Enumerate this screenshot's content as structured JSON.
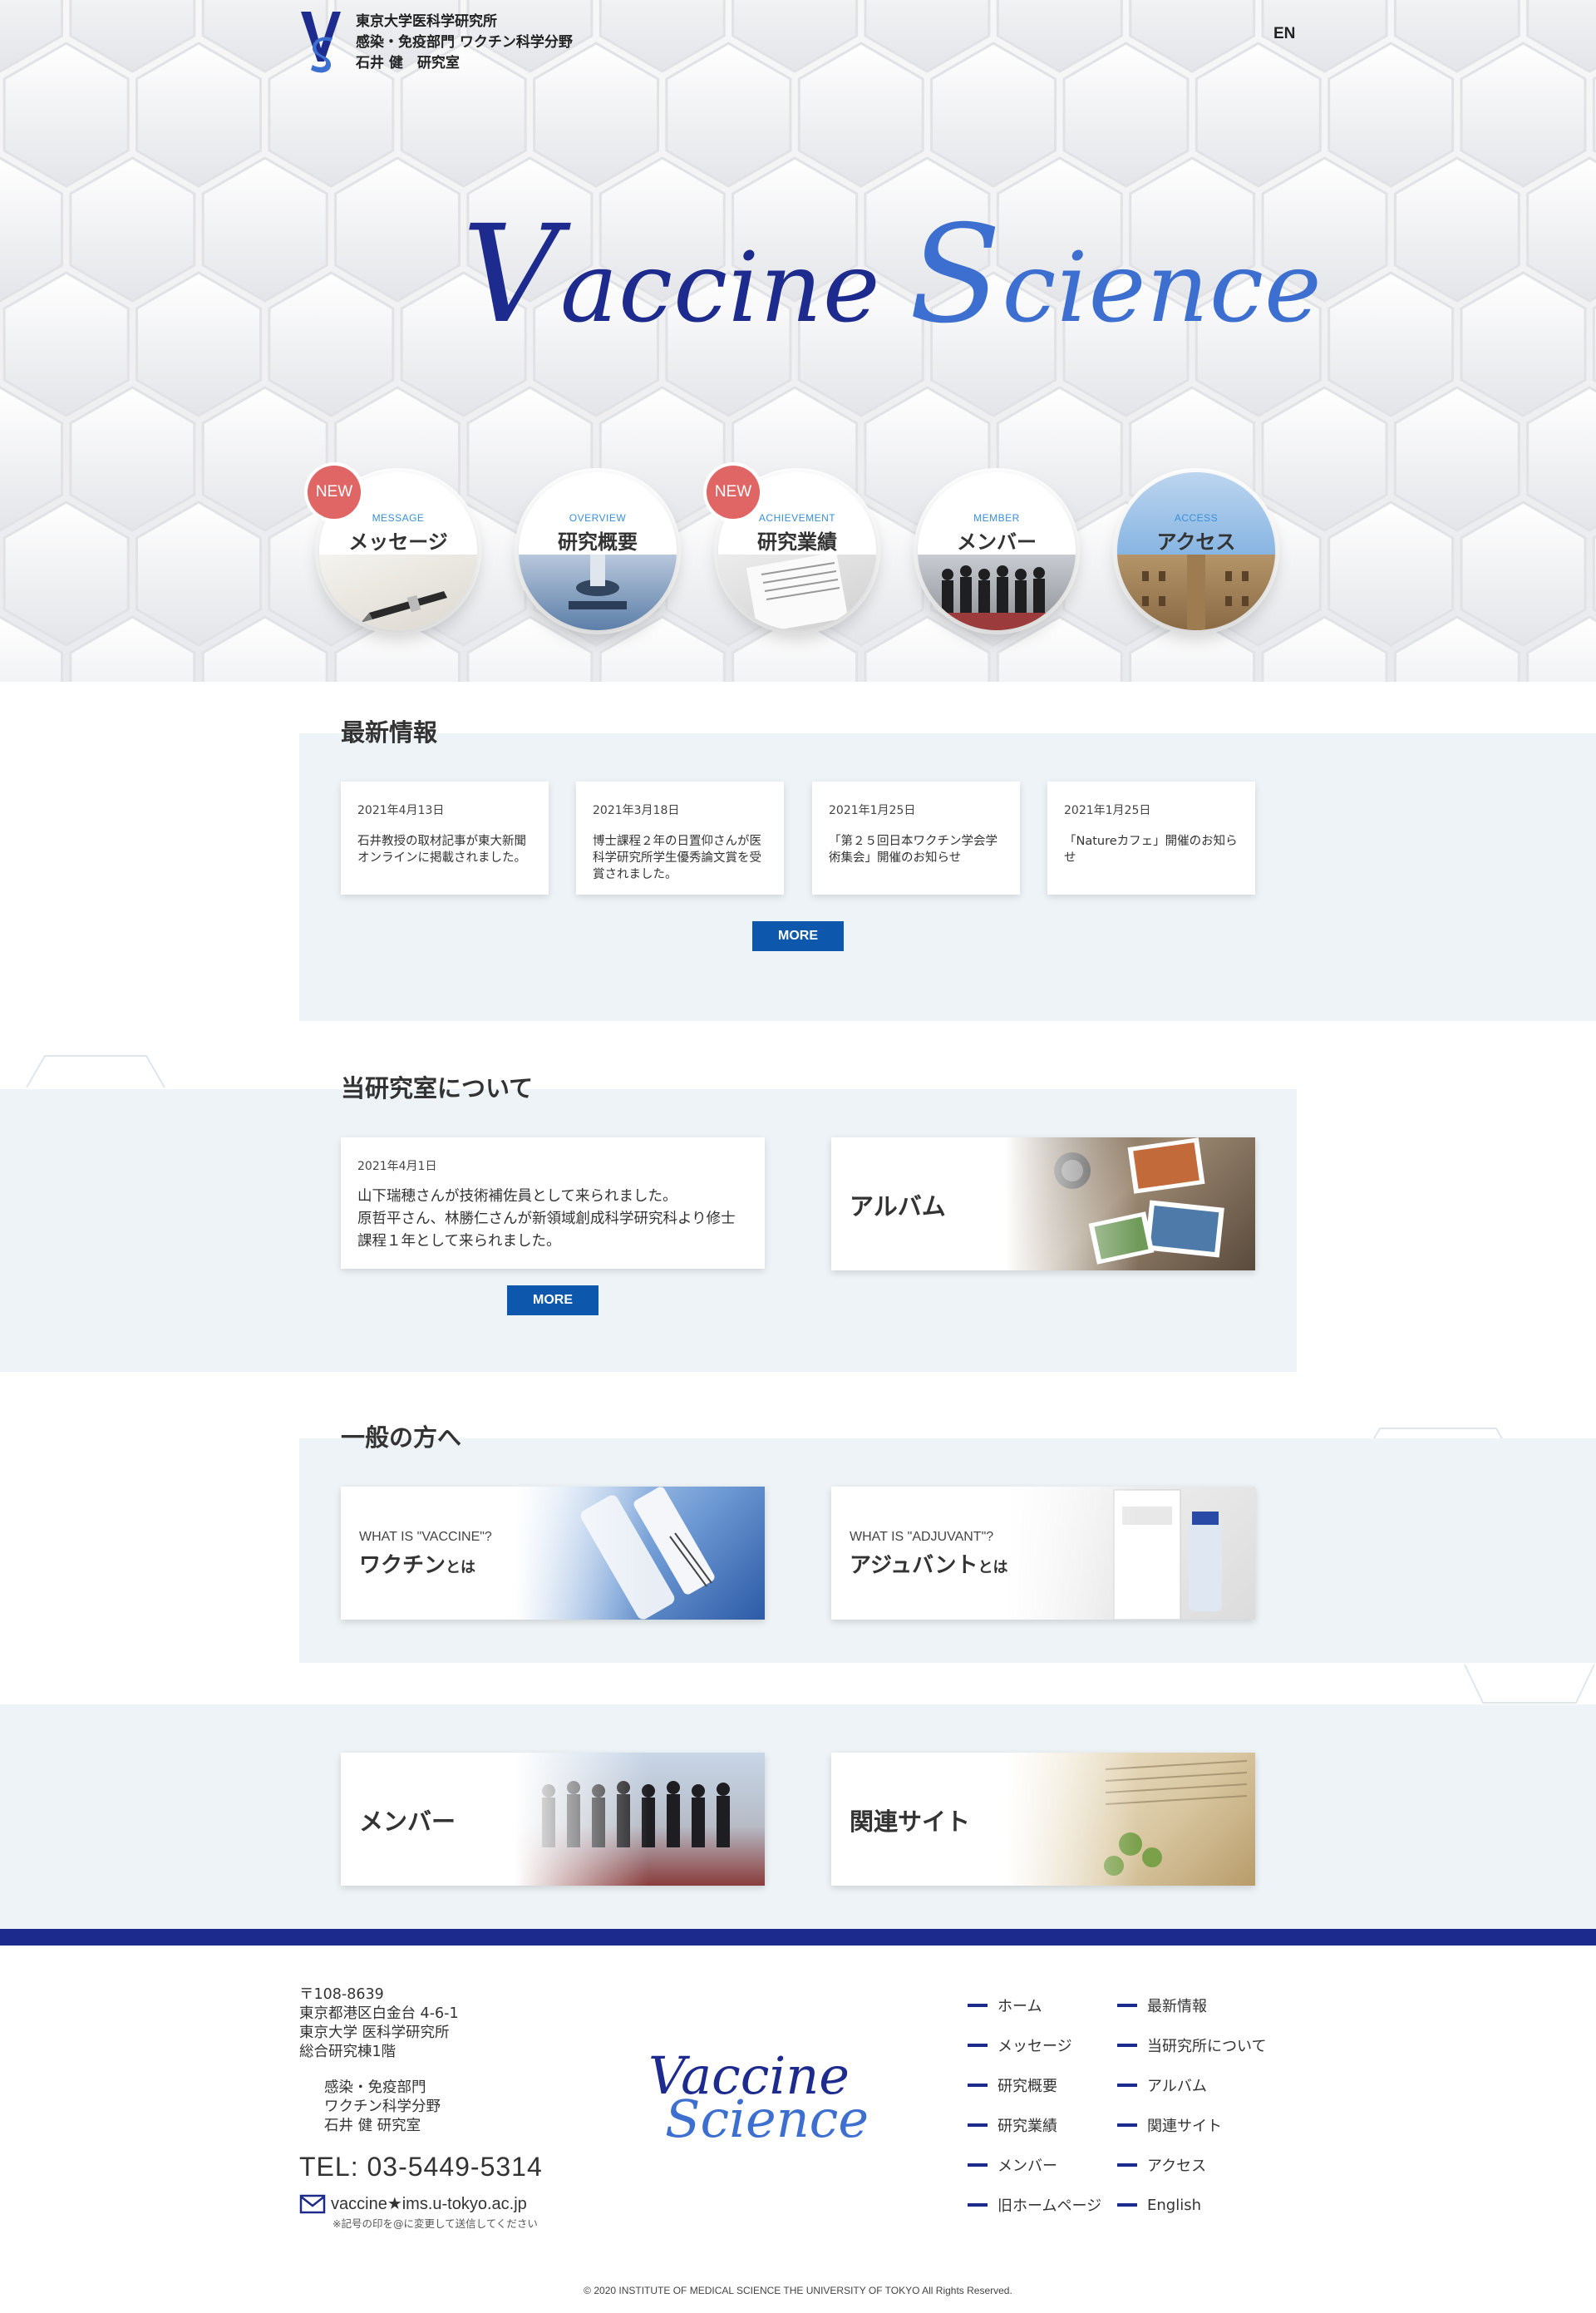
{
  "header": {
    "lab_name_lines": [
      "東京大学医科学研究所",
      "感染・免疫部門 ワクチン科学分野",
      "石井 健　研究室"
    ],
    "lang_link": "EN"
  },
  "hero": {
    "title_word1_cap": "V",
    "title_word1_rest": "accine",
    "title_word2_cap": "S",
    "title_word2_rest": "cience"
  },
  "circle_nav": [
    {
      "en": "MESSAGE",
      "ja": "メッセージ",
      "badge": "NEW"
    },
    {
      "en": "OVERVIEW",
      "ja": "研究概要",
      "badge": ""
    },
    {
      "en": "ACHIEVEMENT",
      "ja": "研究業績",
      "badge": "NEW"
    },
    {
      "en": "MEMBER",
      "ja": "メンバー",
      "badge": ""
    },
    {
      "en": "ACCESS",
      "ja": "アクセス",
      "badge": ""
    }
  ],
  "news": {
    "title": "最新情報",
    "items": [
      {
        "date": "2021年4月13日",
        "text": "石井教授の取材記事が東大新聞オンラインに掲載されました。"
      },
      {
        "date": "2021年3月18日",
        "text": "博士課程２年の日置仰さんが医科学研究所学生優秀論文賞を受賞されました。"
      },
      {
        "date": "2021年1月25日",
        "text": "「第２５回日本ワクチン学会学術集会」開催のお知らせ"
      },
      {
        "date": "2021年1月25日",
        "text": "「Natureカフェ」開催のお知らせ"
      }
    ],
    "more": "MORE"
  },
  "about": {
    "title": "当研究室について",
    "news_date": "2021年4月1日",
    "news_lines": [
      "山下瑞穂さんが技術補佐員として来られました。",
      "原哲平さん、林勝仁さんが新領域創成科学研究科より修士",
      "課程１年として来られました。"
    ],
    "more": "MORE",
    "album": "アルバム"
  },
  "public": {
    "title": "一般の方へ",
    "vaccine_en": "WHAT IS \"VACCINE\"?",
    "vaccine_ja": "ワクチン",
    "vaccine_suffix": "とは",
    "adjuvant_en": "WHAT IS \"ADJUVANT\"?",
    "adjuvant_ja": "アジュバント",
    "adjuvant_suffix": "とは"
  },
  "links": {
    "member": "メンバー",
    "related": "関連サイト"
  },
  "footer": {
    "address_lines": [
      "〒108-8639",
      "東京都港区白金台 4-6-1",
      "東京大学 医科学研究所",
      "総合研究棟1階"
    ],
    "dept_lines": [
      "感染・免疫部門",
      "ワクチン科学分野",
      "石井 健 研究室"
    ],
    "tel": "TEL: 03-5449-5314",
    "email": "vaccine★ims.u-tokyo.ac.jp",
    "email_note": "※記号の印を@に変更して送信してください",
    "logo_line1": "Vaccine",
    "logo_line2": "Science",
    "nav_col1": [
      "ホーム",
      "メッセージ",
      "研究概要",
      "研究業績",
      "メンバー",
      "旧ホームページ"
    ],
    "nav_col2": [
      "最新情報",
      "当研究所について",
      "アルバム",
      "関連サイト",
      "アクセス",
      "English"
    ],
    "copyright": "© 2020 INSTITUTE OF MEDICAL SCIENCE THE UNIVERSITY OF TOKYO All Rights Reserved."
  },
  "colors": {
    "brand_dark": "#1e2b8e",
    "brand_light": "#3d6fd0",
    "more_button": "#0d58ad",
    "badge_new": "#e06565",
    "panel_bg": "#edf3f6",
    "footer_bar": "#1b2a8c"
  }
}
